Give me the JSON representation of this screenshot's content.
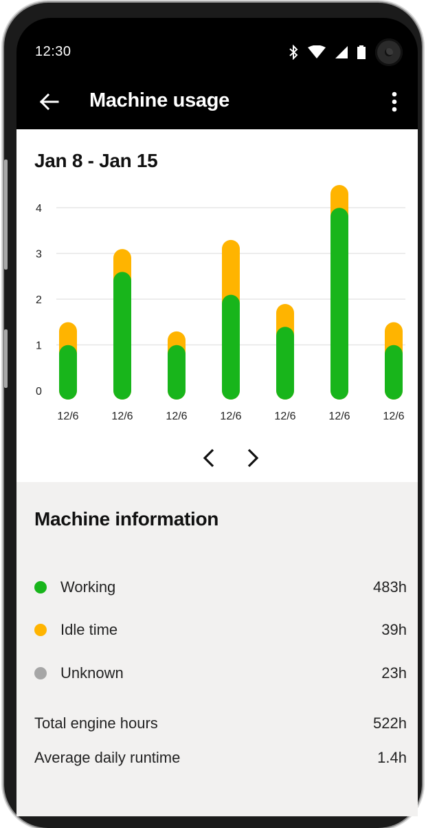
{
  "status_bar": {
    "time": "12:30"
  },
  "app_bar": {
    "title": "Machine usage"
  },
  "usage": {
    "date_range": "Jan 8 - Jan 15"
  },
  "chart_data": {
    "type": "bar",
    "stacked": true,
    "categories": [
      "12/6",
      "12/6",
      "12/6",
      "12/6",
      "12/6",
      "12/6",
      "12/6"
    ],
    "series": [
      {
        "name": "Working",
        "color": "#18b51b",
        "values": [
          0.8,
          2.4,
          0.8,
          1.9,
          1.2,
          3.8,
          0.8
        ]
      },
      {
        "name": "Idle time",
        "color": "#ffb400",
        "values": [
          0.5,
          0.5,
          0.3,
          1.2,
          0.5,
          0.5,
          0.5
        ]
      }
    ],
    "ylim": [
      0,
      4.3
    ],
    "yticks": [
      "0",
      "1",
      "2",
      "3",
      "4"
    ],
    "grid": true
  },
  "machine_info": {
    "heading": "Machine information",
    "legend": [
      {
        "label": "Working",
        "value": "483h",
        "color": "#18b51b"
      },
      {
        "label": "Idle time",
        "value": "39h",
        "color": "#ffb400"
      },
      {
        "label": "Unknown",
        "value": "23h",
        "color": "#a6a6a6"
      }
    ],
    "totals": [
      {
        "label": "Total engine hours",
        "value": "522h"
      },
      {
        "label": "Average daily runtime",
        "value": "1.4h"
      }
    ]
  }
}
